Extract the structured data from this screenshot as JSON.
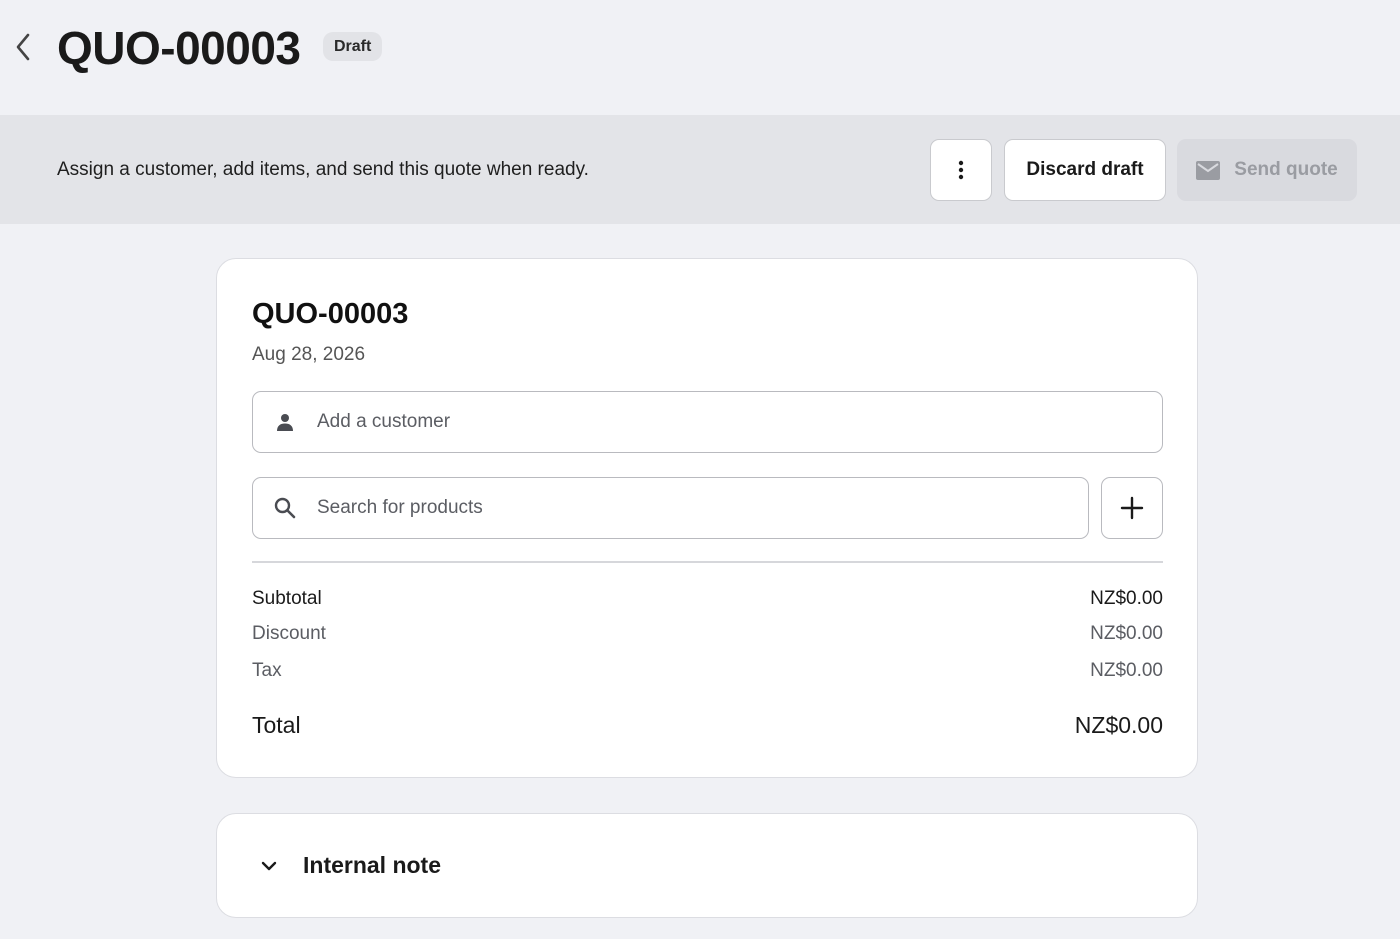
{
  "header": {
    "title": "QUO-00003",
    "status_badge": "Draft"
  },
  "banner": {
    "message": "Assign a customer, add items, and send this quote when ready.",
    "discard_label": "Discard draft",
    "send_label": "Send quote"
  },
  "quote": {
    "number": "QUO-00003",
    "date": "Aug 28, 2026",
    "customer_placeholder": "Add a customer",
    "product_search_placeholder": "Search for products"
  },
  "totals": {
    "subtotal_label": "Subtotal",
    "subtotal_value": "NZ$0.00",
    "discount_label": "Discount",
    "discount_value": "NZ$0.00",
    "tax_label": "Tax",
    "tax_value": "NZ$0.00",
    "total_label": "Total",
    "total_value": "NZ$0.00"
  },
  "note": {
    "label": "Internal note"
  },
  "icons": {
    "back": "chevron-left-icon",
    "more": "more-vertical-icon",
    "send": "mail-icon",
    "customer": "person-icon",
    "search": "search-icon",
    "add": "plus-icon",
    "note": "chevron-down-icon"
  },
  "colors": {
    "page_background": "#f0f1f5",
    "banner_background": "#e3e4e8",
    "disabled_button": "#d9dadf",
    "card_background": "#ffffff"
  }
}
